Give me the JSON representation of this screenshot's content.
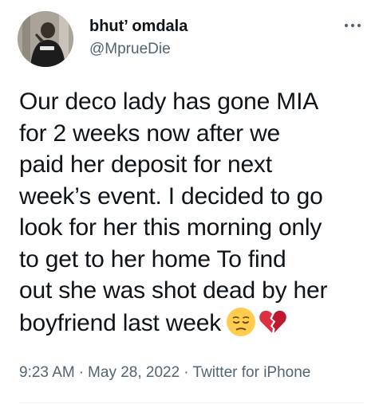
{
  "author": {
    "display_name": "bhut’ omdala",
    "handle": "@MprueDie"
  },
  "tweet": {
    "lines": [
      "Our deco lady has gone MIA",
      "for 2 weeks now after we",
      "paid her deposit for next",
      "week’s event. I decided to go",
      "look for her this morning only",
      "to get to her home To find",
      "out she was shot dead by her",
      "boyfriend last week"
    ],
    "emojis": [
      "pensive-face",
      "broken-heart"
    ]
  },
  "meta": {
    "time": "9:23 AM",
    "separator": "·",
    "date": "May 28, 2022",
    "source": "Twitter for iPhone"
  },
  "icons": {
    "more": "more-horizontal-icon"
  },
  "colors": {
    "text": "#0f1419",
    "secondary": "#536471",
    "divider": "#eff3f4"
  }
}
